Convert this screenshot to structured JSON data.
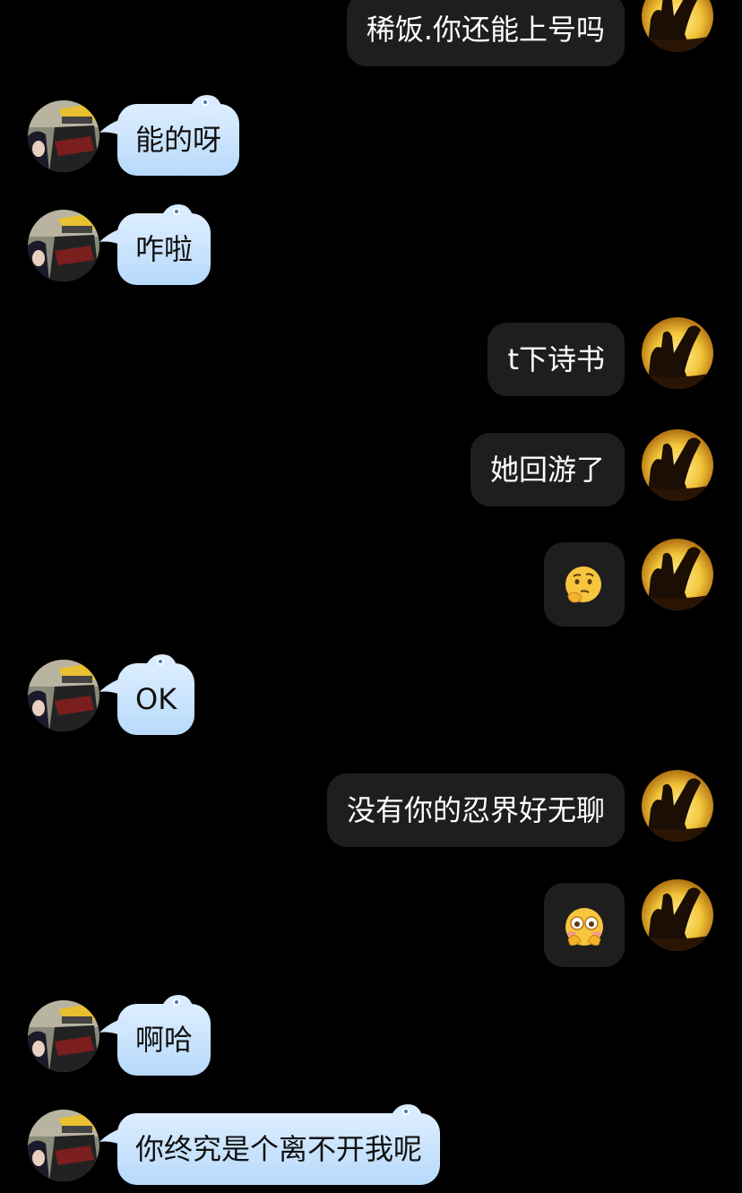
{
  "colors": {
    "background": "#000000",
    "outgoing_bubble": "#1e1e1e",
    "incoming_bubble_top": "#ddeeff",
    "incoming_bubble_bottom": "#b7d9fb",
    "outgoing_text": "#ffffff",
    "incoming_text": "#111111"
  },
  "messages": [
    {
      "side": "out",
      "type": "text",
      "text": "稀饭.你还能上号吗"
    },
    {
      "side": "in",
      "type": "text",
      "text": "能的呀"
    },
    {
      "side": "in",
      "type": "text",
      "text": "咋啦"
    },
    {
      "side": "out",
      "type": "text",
      "text": "t下诗书"
    },
    {
      "side": "out",
      "type": "text",
      "text": "她回游了"
    },
    {
      "side": "out",
      "type": "emoji",
      "emoji": "thinking-face-emoji"
    },
    {
      "side": "in",
      "type": "text",
      "text": "OK"
    },
    {
      "side": "out",
      "type": "text",
      "text": "没有你的忍界好无聊"
    },
    {
      "side": "out",
      "type": "emoji",
      "emoji": "shy-peek-face-emoji"
    },
    {
      "side": "in",
      "type": "text",
      "text": "啊哈"
    },
    {
      "side": "in",
      "type": "text",
      "text": "你终究是个离不开我呢"
    }
  ],
  "avatars": {
    "self": "silhouette-sunset-avatar",
    "contact": "anime-characters-avatar"
  }
}
